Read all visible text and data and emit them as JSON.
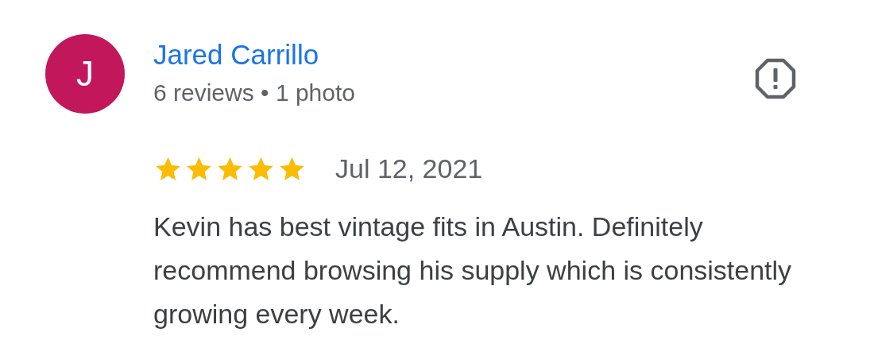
{
  "review": {
    "author": {
      "name": "Jared Carrillo",
      "initial": "J",
      "color": "#c2185b",
      "meta": "6 reviews • 1 photo"
    },
    "stars": 5,
    "date": "Jul 12, 2021",
    "text": "Kevin has best vintage fits in Austin. Definitely recommend browsing his supply which is consistently growing every week."
  }
}
